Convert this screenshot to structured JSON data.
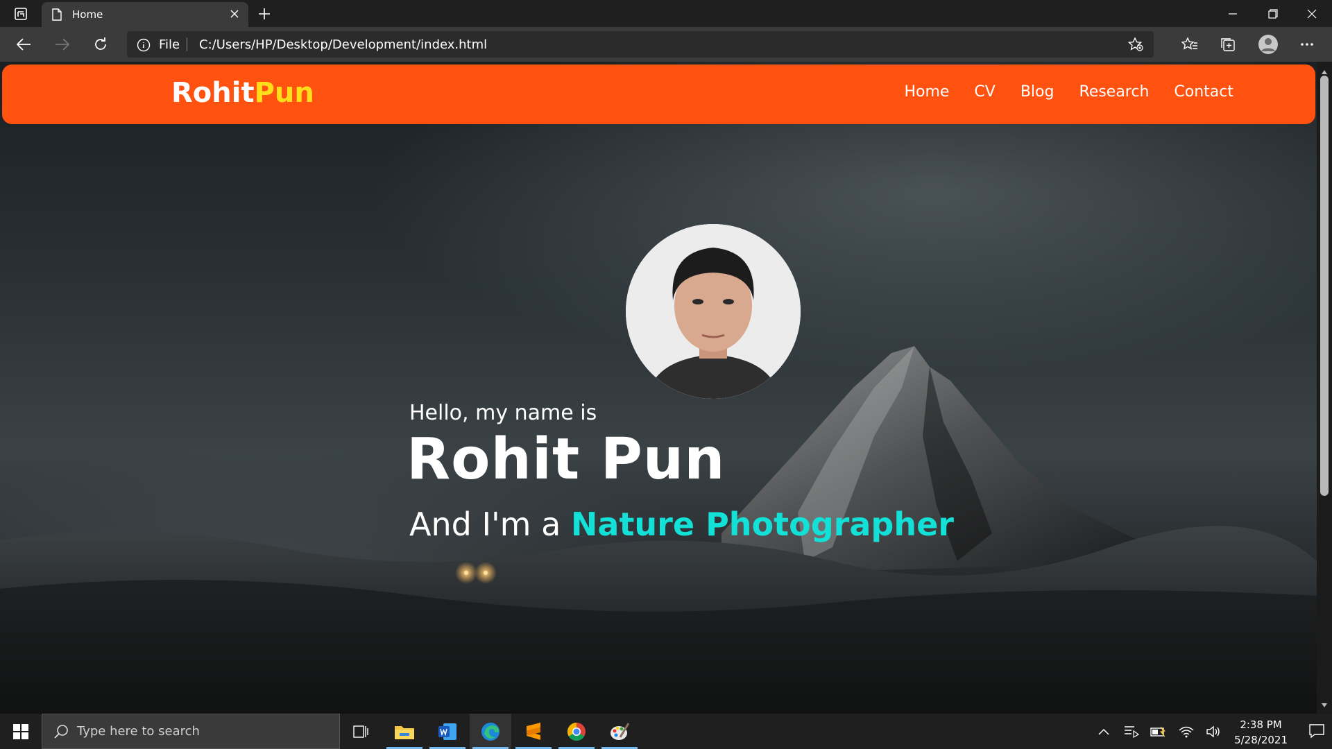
{
  "browser": {
    "tab_title": "Home",
    "address_label": "File",
    "url": "C:/Users/HP/Desktop/Development/index.html"
  },
  "site": {
    "brand_first": "Rohit",
    "brand_second": "Pun",
    "nav": [
      "Home",
      "CV",
      "Blog",
      "Research",
      "Contact"
    ],
    "greeting": "Hello, my name is",
    "name": "Rohit Pun",
    "tagline_prefix": "And I'm a",
    "tagline_role": "Nature Photographer"
  },
  "taskbar": {
    "search_placeholder": "Type here to search",
    "time": "2:38 PM",
    "date": "5/28/2021"
  },
  "colors": {
    "nav_bg": "#ff510f",
    "brand_accent": "#ffdf1b",
    "role_accent": "#13e0d6"
  }
}
